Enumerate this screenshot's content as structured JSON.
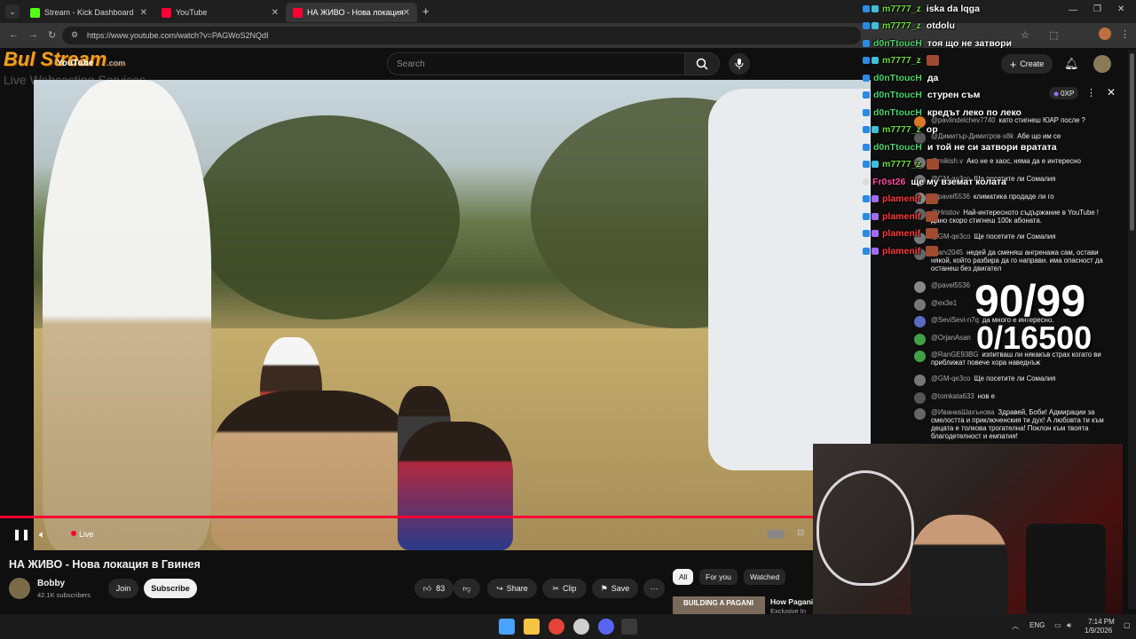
{
  "browser": {
    "tabs": [
      {
        "label": "Stream - Kick Dashboard",
        "color": "#53fc18"
      },
      {
        "label": "YouTube",
        "color": "#ff0033"
      },
      {
        "label": "НА ЖИВО - Нова локация",
        "color": "#ff0033"
      }
    ],
    "new_tab": "+",
    "url": "https://www.youtube.com/watch?v=PAGWoS2NQdI"
  },
  "youtube": {
    "logo_text": "YouTube",
    "search_placeholder": "Search",
    "create_label": "Create",
    "video_title": "НА ЖИВО - Нова локация в Гвинея",
    "channel_name": "Bobby",
    "subscribers": "42.1K subscribers",
    "join_label": "Join",
    "subscribe_label": "Subscribe",
    "like_count": "83",
    "share_label": "Share",
    "clip_label": "Clip",
    "save_label": "Save",
    "live_label": "Live",
    "chips": [
      "All",
      "For you",
      "Watched"
    ],
    "rec_title": "How Pagani",
    "rec_sub": "Exclusive In",
    "rec_thumb_text": "BUILDING A PAGANI"
  },
  "watermark": {
    "logo": "Bul Stream",
    "domain": ".com",
    "tagline": "Live Webcasting Services"
  },
  "kick_chat": [
    {
      "user": "m7777_z",
      "msg": "iska da lqga",
      "color": "#6bdc3c"
    },
    {
      "user": "m7777_z",
      "msg": "otdolu",
      "color": "#6bdc3c"
    },
    {
      "user": "d0nTtoucH",
      "msg": "тоя що не затвори",
      "color": "#4bd36b"
    },
    {
      "user": "m7777_z",
      "msg": "",
      "color": "#6bdc3c"
    },
    {
      "user": "d0nTtoucH",
      "msg": "да",
      "color": "#4bd36b"
    },
    {
      "user": "d0nTtoucH",
      "msg": "стурен съм",
      "color": "#4bd36b"
    },
    {
      "user": "d0nTtoucH",
      "msg": "кредът леко по леко",
      "color": "#4bd36b"
    },
    {
      "user": "m7777_z",
      "msg": "ор",
      "color": "#6bdc3c"
    },
    {
      "user": "d0nTtoucH",
      "msg": "и той не си затвори вратата",
      "color": "#4bd36b"
    },
    {
      "user": "m7777_z",
      "msg": "",
      "color": "#6bdc3c"
    },
    {
      "user": "Fr0st26",
      "msg": "ще му вземат колата",
      "color": "#ff4da6"
    },
    {
      "user": "plamenif",
      "msg": "",
      "color": "#ff3b3b"
    },
    {
      "user": "plamenif",
      "msg": "",
      "color": "#ff3b3b"
    },
    {
      "user": "plamenif",
      "msg": "",
      "color": "#ff3b3b"
    },
    {
      "user": "plamenif",
      "msg": "",
      "color": "#ff3b3b"
    }
  ],
  "yt_chat": {
    "xp": "0XP",
    "messages": [
      {
        "user": "@pavlindelchev7740",
        "msg": "като стигнеш ЮАР после ?",
        "avatar": "#d97a2b"
      },
      {
        "user": "@Димитър-Димитров-x8k",
        "msg": "Абе що им се",
        "avatar": "#5a5a5a"
      },
      {
        "user": "@mikish.v",
        "msg": "Ако не е хаос, няма да е интересно",
        "avatar": "#777"
      },
      {
        "user": "@GM-qe3co",
        "msg": "Ще посетите ли Сомалия",
        "avatar": "#777"
      },
      {
        "user": "@pavel5536",
        "msg": "климатика продаде ли го",
        "avatar": "#888"
      },
      {
        "user": "@Hristov",
        "msg": "Най-интересното съдържание в YouTube ! Дано скоро стигнеш 100к абоната.",
        "avatar": "#666"
      },
      {
        "user": "@GM-qe3co",
        "msg": "Ще посетите ли Сомалия",
        "avatar": "#777"
      },
      {
        "user": "@arv2045",
        "msg": "недей да сменяш ангренажа сам, остави някой, който разбира да го направи. има опасност да останеш без двигател",
        "avatar": "#666"
      },
      {
        "user": "@pavel5536",
        "msg": "",
        "avatar": "#888"
      },
      {
        "user": "@ex3e1",
        "msg": "",
        "avatar": "#777"
      },
      {
        "user": "@SeviSevi-n7q",
        "msg": "да много е интересно.",
        "avatar": "#5c6bc0"
      },
      {
        "user": "@OrjanAsan",
        "msg": "",
        "avatar": "#43a047"
      },
      {
        "user": "@RanGE93BG",
        "msg": "изпитваш ли някакъв страх когато ви приближат повече хора наведнъж",
        "avatar": "#43a047"
      },
      {
        "user": "@GM-qe3co",
        "msg": "Ще посетите ли Сомалия",
        "avatar": "#777"
      },
      {
        "user": "@tomkata633",
        "msg": "нов е",
        "avatar": "#555"
      },
      {
        "user": "@ИванкаШахънова",
        "msg": "Здравей, Боби! Адмирации за смелостта и приключенския ти дух! А любовта ти към децата е толкова трогателна! Поклон към твоята благодетелност и емпатия!",
        "avatar": "#666"
      }
    ]
  },
  "counter": {
    "line1": "90/99",
    "line2": "0/16500"
  },
  "taskbar": {
    "lang": "ENG",
    "time": "7:14 PM",
    "date": "1/9/2026",
    "icons": [
      {
        "name": "windows-start",
        "color": "#4aa3ff"
      },
      {
        "name": "file-explorer",
        "color": "#f6c443"
      },
      {
        "name": "chrome",
        "color": "#e54335"
      },
      {
        "name": "openai",
        "color": "#cfcfcf"
      },
      {
        "name": "discord",
        "color": "#5865f2"
      },
      {
        "name": "terminal",
        "color": "#3a3a3a"
      }
    ]
  }
}
